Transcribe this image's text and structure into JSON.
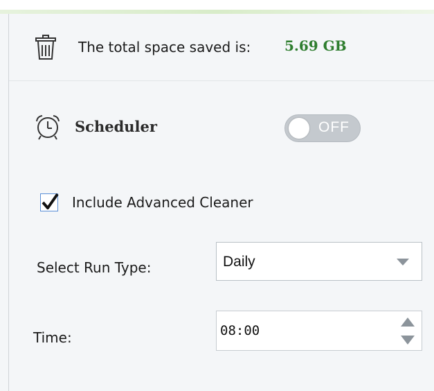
{
  "summary": {
    "icon": "trash-icon",
    "label": "The total space saved is:",
    "value": "5.69 GB",
    "value_color": "#2e7d2e"
  },
  "scheduler": {
    "icon": "alarm-clock-icon",
    "label": "Scheduler",
    "toggle_state": "OFF",
    "toggle_on": false
  },
  "advanced_cleaner": {
    "label": "Include Advanced Cleaner",
    "checked": true
  },
  "run_type": {
    "label": "Select Run Type:",
    "selected": "Daily"
  },
  "time": {
    "label": "Time:",
    "value": "08:00"
  }
}
